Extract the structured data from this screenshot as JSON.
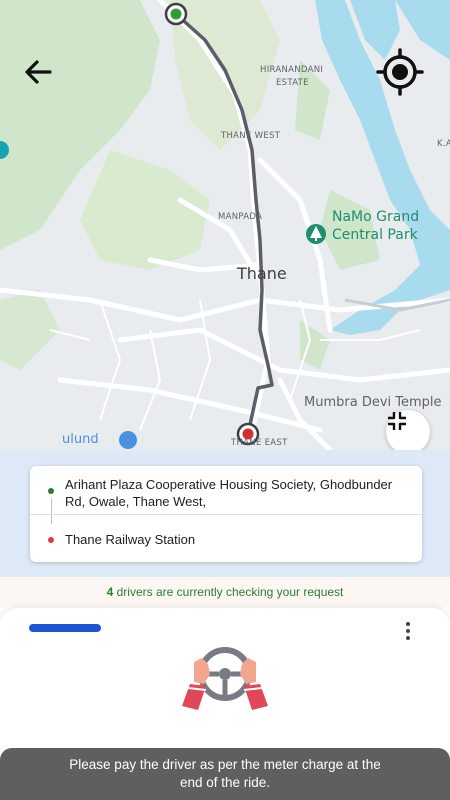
{
  "map": {
    "labels": {
      "hiranandani_line1": "HIRANANDANI",
      "hiranandani_line2": "ESTATE",
      "thane_west": "THANE WEST",
      "manpada": "MANPADA",
      "thane": "Thane",
      "namo_line1": "NaMo Grand",
      "namo_line2": "Central Park",
      "mumbra": "Mumbra Devi Temple",
      "thane_east": "THANE EAST",
      "mulund": "ulund",
      "ka": "K.A"
    }
  },
  "colors": {
    "pickup": "#2e7d32",
    "drop": "#e53935",
    "accent": "#1a56d6",
    "status_text": "#2e7d32",
    "toast_bg": "#5f5f5f"
  },
  "route": {
    "pickup_address": "Arihant Plaza Cooperative Housing Society, Ghodbunder Rd, Owale, Thane West,",
    "drop_address": "Thane Railway Station"
  },
  "status": {
    "driver_count": "4",
    "message": "drivers are currently checking your request"
  },
  "icons": {
    "back": "arrow-left-icon",
    "locate": "crosshair-icon",
    "fit": "collapse-icon",
    "menu": "more-vertical-icon",
    "illustration": "steering-wheel-icon"
  },
  "toast": {
    "message": "Please pay the driver as per the meter charge at the end of the ride."
  }
}
